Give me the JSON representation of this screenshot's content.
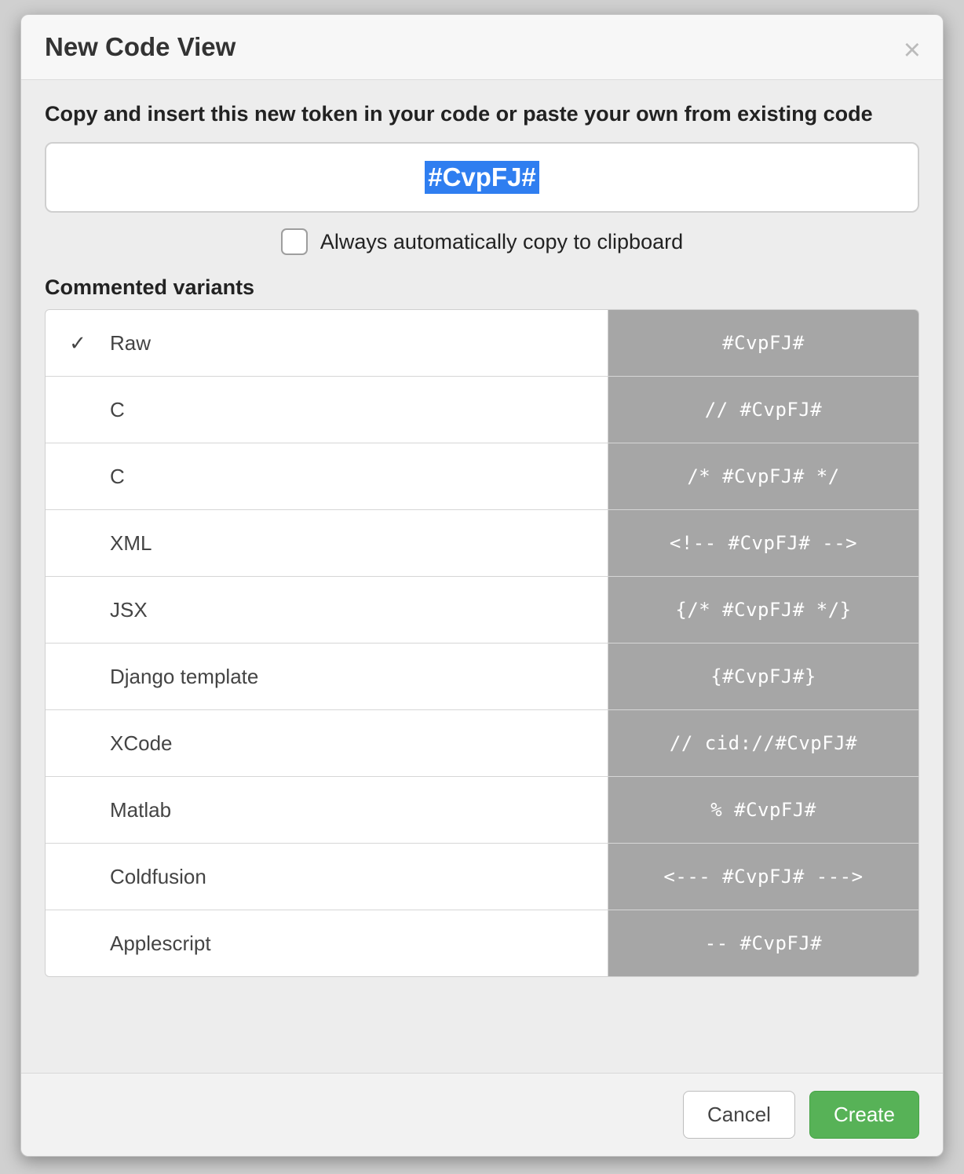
{
  "modal": {
    "title": "New Code View",
    "instruction": "Copy and insert this new token in your code or paste your own from existing code",
    "token": "#CvpFJ#",
    "autoCopyLabel": "Always automatically copy to clipboard",
    "autoCopyChecked": false,
    "variantsTitle": "Commented variants",
    "variants": [
      {
        "selected": true,
        "label": "Raw",
        "code": "#CvpFJ#"
      },
      {
        "selected": false,
        "label": "C",
        "code": "// #CvpFJ#"
      },
      {
        "selected": false,
        "label": "C",
        "code": "/* #CvpFJ# */"
      },
      {
        "selected": false,
        "label": "XML",
        "code": "<!-- #CvpFJ# -->"
      },
      {
        "selected": false,
        "label": "JSX",
        "code": "{/* #CvpFJ# */}"
      },
      {
        "selected": false,
        "label": "Django template",
        "code": "{#CvpFJ#}"
      },
      {
        "selected": false,
        "label": "XCode",
        "code": "// cid://#CvpFJ#"
      },
      {
        "selected": false,
        "label": "Matlab",
        "code": "% #CvpFJ#"
      },
      {
        "selected": false,
        "label": "Coldfusion",
        "code": "<--- #CvpFJ# --->"
      },
      {
        "selected": false,
        "label": "Applescript",
        "code": "-- #CvpFJ#"
      }
    ],
    "cancelLabel": "Cancel",
    "createLabel": "Create"
  }
}
